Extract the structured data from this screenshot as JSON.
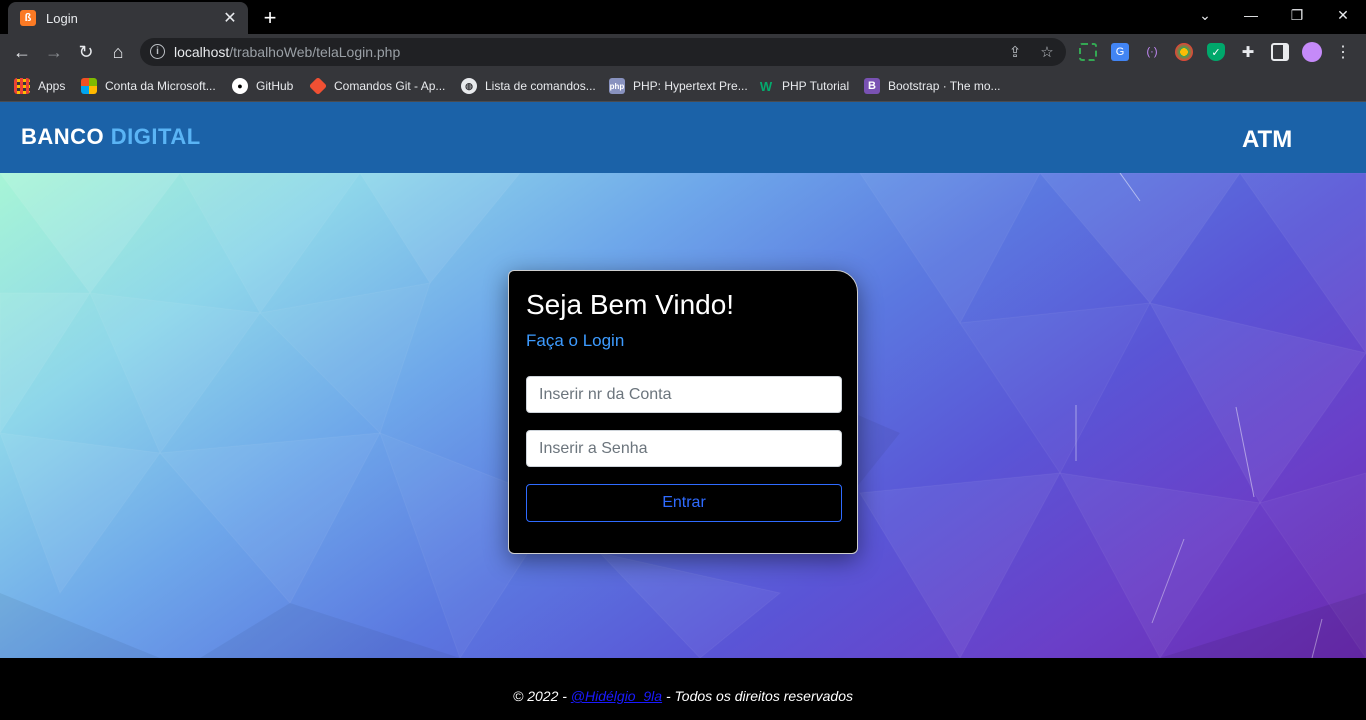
{
  "browser": {
    "tab_title": "Login",
    "url_host": "localhost",
    "url_path": "/trabalhoWeb/telaLogin.php",
    "bookmarks": [
      {
        "label": "Apps",
        "icon": "apps-grid-icon"
      },
      {
        "label": "Conta da Microsoft...",
        "icon": "microsoft-icon"
      },
      {
        "label": "GitHub",
        "icon": "github-icon"
      },
      {
        "label": "Comandos Git - Ap...",
        "icon": "git-icon"
      },
      {
        "label": "Lista de comandos...",
        "icon": "globe-icon"
      },
      {
        "label": "PHP: Hypertext Pre...",
        "icon": "php-icon"
      },
      {
        "label": "PHP Tutorial",
        "icon": "w3schools-icon"
      },
      {
        "label": "Bootstrap · The mo...",
        "icon": "bootstrap-icon"
      }
    ]
  },
  "header": {
    "brand_main": "BANCO",
    "brand_accent": "DIGITAL",
    "right_label": "ATM"
  },
  "login": {
    "title": "Seja Bem Vindo!",
    "subtitle": "Faça o Login",
    "account_placeholder": "Inserir nr da Conta",
    "password_placeholder": "Inserir a Senha",
    "submit_label": "Entrar"
  },
  "footer": {
    "prefix": "© 2022 - ",
    "handle": "@Hidélgio_9la",
    "suffix": " - Todos os direitos reservados"
  },
  "colors": {
    "header_bg": "#1b62a8",
    "brand_accent": "#5ab4f5",
    "link_blue": "#3d9bff",
    "button_border": "#2f6bff"
  }
}
